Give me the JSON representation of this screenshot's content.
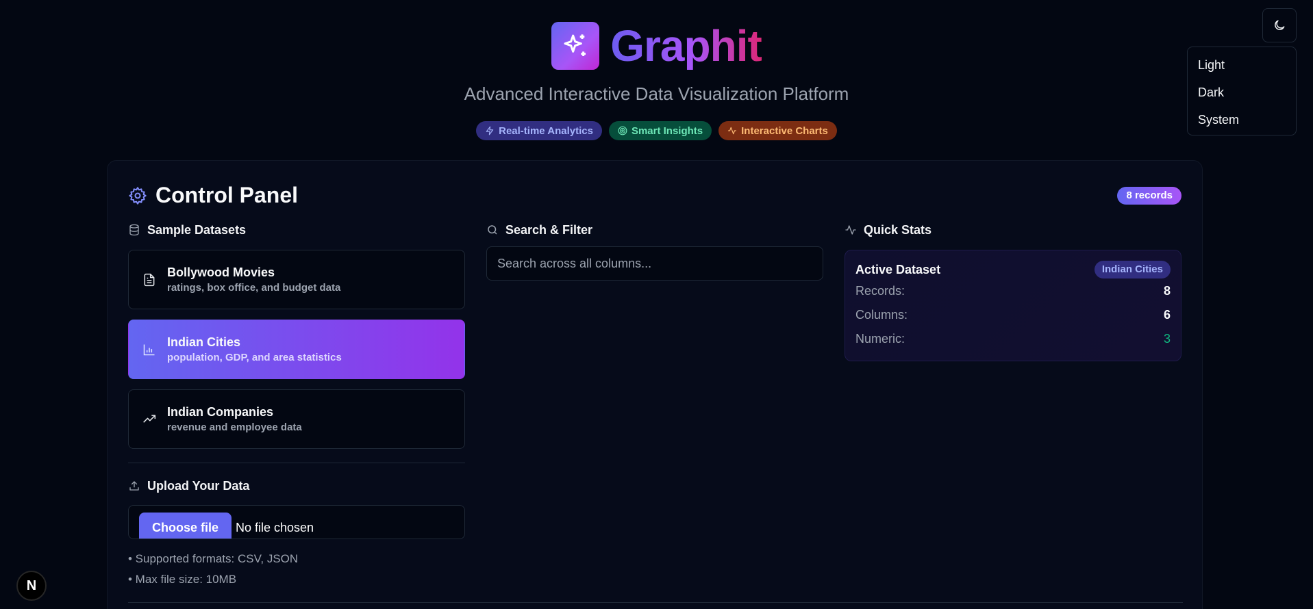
{
  "brand": {
    "title": "Graphit",
    "tagline": "Advanced Interactive Data Visualization Platform"
  },
  "badges": [
    {
      "label": "Real-time Analytics",
      "icon": "zap-icon"
    },
    {
      "label": "Smart Insights",
      "icon": "target-icon"
    },
    {
      "label": "Interactive Charts",
      "icon": "activity-icon"
    }
  ],
  "theme": {
    "icon": "moon-icon",
    "options": [
      "Light",
      "Dark",
      "System"
    ]
  },
  "panel": {
    "title": "Control Panel",
    "records_badge": "8 records",
    "datasets": {
      "heading": "Sample Datasets",
      "items": [
        {
          "name": "Bollywood Movies",
          "desc": "ratings, box office, and budget data",
          "icon": "file-text-icon",
          "active": false
        },
        {
          "name": "Indian Cities",
          "desc": "population, GDP, and area statistics",
          "icon": "bar-chart-icon",
          "active": true
        },
        {
          "name": "Indian Companies",
          "desc": "revenue and employee data",
          "icon": "trending-up-icon",
          "active": false
        }
      ]
    },
    "upload": {
      "heading": "Upload Your Data",
      "button": "Choose file",
      "status": "No file chosen",
      "hints": [
        "• Supported formats: CSV, JSON",
        "• Max file size: 10MB"
      ]
    },
    "search": {
      "heading": "Search & Filter",
      "placeholder": "Search across all columns..."
    },
    "stats": {
      "heading": "Quick Stats",
      "card_title": "Active Dataset",
      "dataset_pill": "Indian Cities",
      "rows": [
        {
          "label": "Records:",
          "value": "8"
        },
        {
          "label": "Columns:",
          "value": "6"
        },
        {
          "label": "Numeric:",
          "value": "3"
        }
      ]
    }
  },
  "next_badge": "N",
  "colors": {
    "accent": "#6366f1",
    "accent2": "#a855f7",
    "background": "#030712",
    "numeric_value": "#10b981"
  }
}
